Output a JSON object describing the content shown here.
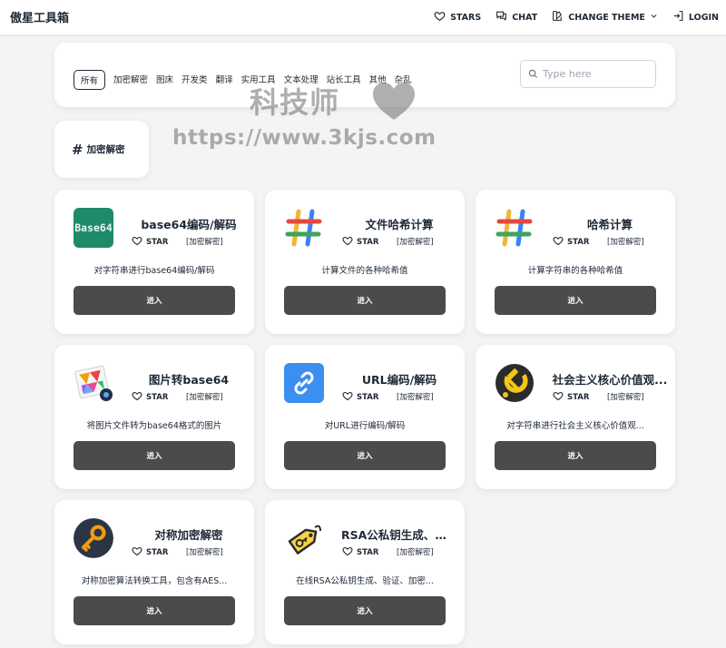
{
  "header": {
    "brand": "傲星工具箱",
    "nav": [
      {
        "label": "STARS",
        "icon": "heart-icon"
      },
      {
        "label": "CHAT",
        "icon": "chat-icon"
      },
      {
        "label": "CHANGE THEME",
        "icon": "theme-icon"
      },
      {
        "label": "LOGIN",
        "icon": "login-icon"
      }
    ]
  },
  "filters": {
    "categories": [
      "所有",
      "加密解密",
      "图床",
      "开发类",
      "翻译",
      "实用工具",
      "文本处理",
      "站长工具",
      "其他",
      "杂乱"
    ],
    "active": "所有",
    "search_placeholder": "Type here"
  },
  "watermark": {
    "line1": "科技师",
    "line2": "https://www.3kjs.com"
  },
  "section": {
    "hash": "#",
    "title": "加密解密"
  },
  "cards": [
    {
      "title": "base64编码/解码",
      "star": "STAR",
      "tag": "[加密解密]",
      "desc": "对字符串进行base64编码/解码",
      "button": "进入",
      "icon": "base64-icon",
      "icon_text": "Base64"
    },
    {
      "title": "文件哈希计算",
      "star": "STAR",
      "tag": "[加密解密]",
      "desc": "计算文件的各种哈希值",
      "button": "进入",
      "icon": "hash-icon"
    },
    {
      "title": "哈希计算",
      "star": "STAR",
      "tag": "[加密解密]",
      "desc": "计算字符串的各种哈希值",
      "button": "进入",
      "icon": "hash-icon"
    },
    {
      "title": "图片转base64",
      "star": "STAR",
      "tag": "[加密解密]",
      "desc": "将图片文件转为base64格式的图片",
      "button": "进入",
      "icon": "image-icon"
    },
    {
      "title": "URL编码/解码",
      "star": "STAR",
      "tag": "[加密解密]",
      "desc": "对URL进行编码/解码",
      "button": "进入",
      "icon": "link-icon"
    },
    {
      "title": "社会主义核心价值观...",
      "star": "STAR",
      "tag": "[加密解密]",
      "desc": "对字符串进行社会主义核心价值观...",
      "button": "进入",
      "icon": "hammer-sickle-icon"
    },
    {
      "title": "对称加密解密",
      "star": "STAR",
      "tag": "[加密解密]",
      "desc": "对称加密算法转换工具，包含有AES...",
      "button": "进入",
      "icon": "key-icon"
    },
    {
      "title": "RSA公私钥生成、验...",
      "star": "STAR",
      "tag": "[加密解密]",
      "desc": "在线RSA公私钥生成、验证、加密...",
      "button": "进入",
      "icon": "key-tag-icon"
    }
  ],
  "colors": {
    "background": "#f4f4f5",
    "card": "#ffffff",
    "button": "#4b4b4b",
    "text": "#1f2937",
    "link_icon_bg": "#3b8ff0",
    "base64_icon_bg": "#1e8a6a"
  }
}
